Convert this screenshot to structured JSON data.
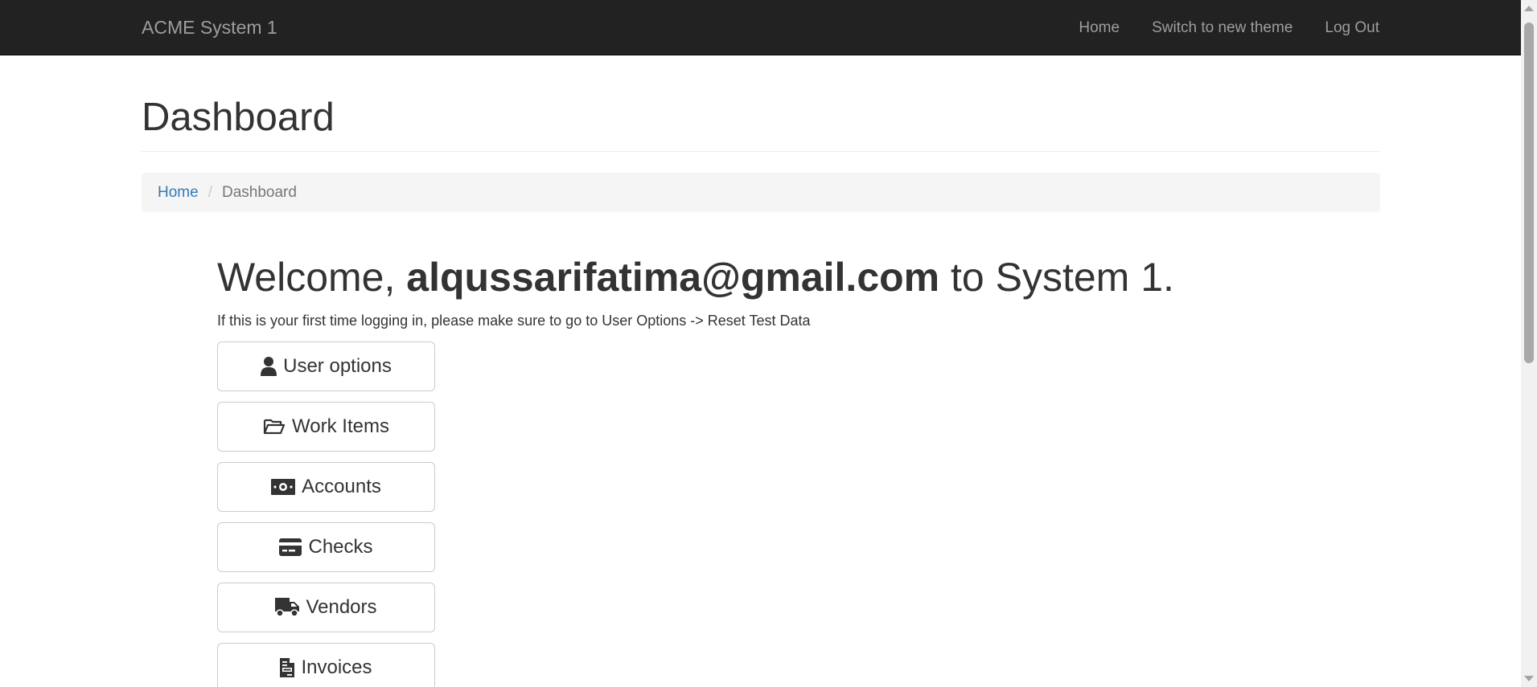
{
  "navbar": {
    "brand": "ACME System 1",
    "links": [
      "Home",
      "Switch to new theme",
      "Log Out"
    ]
  },
  "header": {
    "title": "Dashboard"
  },
  "breadcrumb": {
    "home": "Home",
    "separator": "/",
    "current": "Dashboard"
  },
  "welcome": {
    "prefix": "Welcome, ",
    "email": "alqussarifatima@gmail.com",
    "suffix": " to System 1.",
    "hint": "If this is your first time logging in, please make sure to go to User Options -> Reset Test Data"
  },
  "buttons": [
    {
      "label": "User options",
      "icon": "user-icon"
    },
    {
      "label": "Work Items",
      "icon": "folder-open-icon"
    },
    {
      "label": "Accounts",
      "icon": "money-bill-icon"
    },
    {
      "label": "Checks",
      "icon": "credit-card-icon"
    },
    {
      "label": "Vendors",
      "icon": "truck-icon"
    },
    {
      "label": "Invoices",
      "icon": "file-invoice-icon"
    }
  ],
  "colors": {
    "navbar_bg": "#222222",
    "navbar_text": "#9d9d9d",
    "link": "#337ab7",
    "breadcrumb_bg": "#f5f5f5"
  }
}
